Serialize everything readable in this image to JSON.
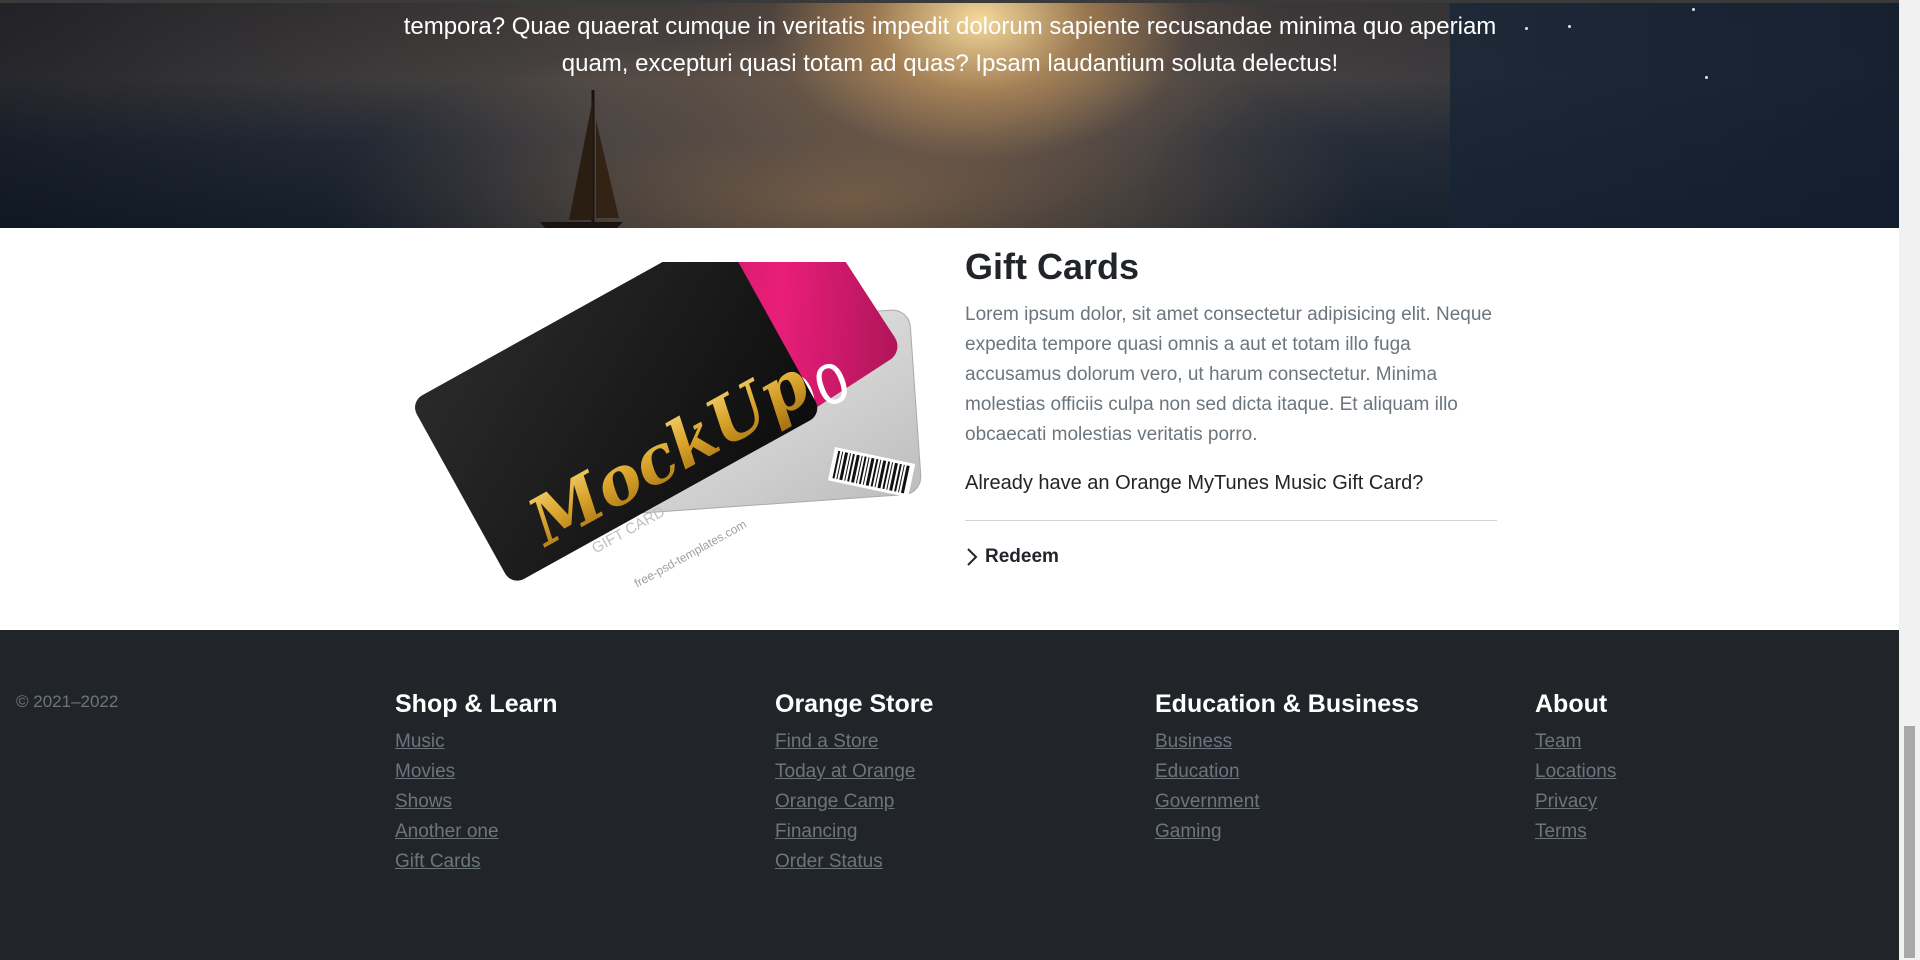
{
  "hero": {
    "text": "tempora? Quae quaerat cumque in veritatis impedit dolorum sapiente recusandae minima quo aperiam quam, excepturi quasi totam ad quas? Ipsam laudantium soluta delectus!"
  },
  "gift": {
    "title": "Gift Cards",
    "description": "Lorem ipsum dolor, sit amet consectetur adipisicing elit. Neque expedita tempore quasi omnis a aut et totam illo fuga accusamus dolorum vero, ut harum consectetur. Minima molestias officiis culpa non sed dicta itaque. Et aliquam illo obcaecati molestias veritatis porro.",
    "question": "Already have an Orange MyTunes Music Gift Card?",
    "redeem_label": "Redeem",
    "card_brand": "MockUp",
    "card_subtitle": "GIFT CARD",
    "card_url": "free-psd-templates.com",
    "card_value_partial": "00"
  },
  "footer": {
    "copyright": "© 2021–2022",
    "columns": [
      {
        "title": "Shop & Learn",
        "links": [
          "Music",
          "Movies",
          "Shows",
          "Another one",
          "Gift Cards"
        ]
      },
      {
        "title": "Orange Store",
        "links": [
          "Find a Store",
          "Today at Orange",
          "Orange Camp",
          "Financing",
          "Order Status"
        ]
      },
      {
        "title": "Education & Business",
        "links": [
          "Business",
          "Education",
          "Government",
          "Gaming"
        ]
      },
      {
        "title": "About",
        "links": [
          "Team",
          "Locations",
          "Privacy",
          "Terms"
        ]
      }
    ]
  },
  "colors": {
    "footer_bg": "#212529",
    "text_dark": "#212529",
    "text_muted": "#6c757d",
    "card_black": "#1b1b1b",
    "card_pink": "#d81b72",
    "card_gold": "#e8b030"
  }
}
